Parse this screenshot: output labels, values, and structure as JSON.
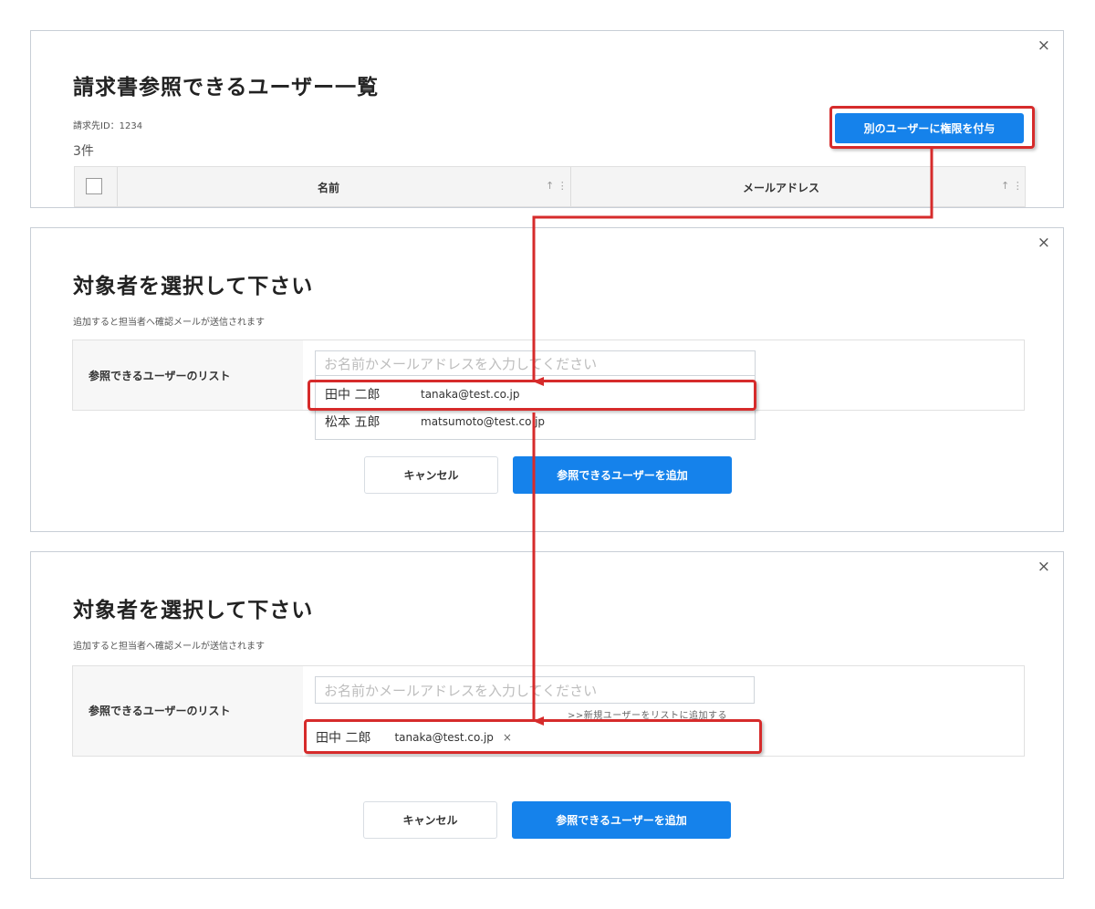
{
  "close_icon": "×",
  "panel1": {
    "title": "請求書参照できるユーザー一覧",
    "billing_id": "請求先ID：1234",
    "count": "3件",
    "grant_button": "別のユーザーに権限を付与",
    "columns": [
      {
        "label": "名前",
        "sort": "↑ ⋮"
      },
      {
        "label": "メールアドレス",
        "sort": "↑ ⋮"
      }
    ]
  },
  "panel2": {
    "title": "対象者を選択して下さい",
    "note": "追加すると担当者へ確認メールが送信されます",
    "field_label": "参照できるユーザーのリスト",
    "search_placeholder": "お名前かメールアドレスを入力してください",
    "options": [
      {
        "name": "田中 二郎",
        "email": "tanaka@test.co.jp"
      },
      {
        "name": "松本 五郎",
        "email": "matsumoto@test.co.jp"
      }
    ],
    "cancel_button": "キャンセル",
    "add_button": "参照できるユーザーを追加"
  },
  "panel3": {
    "title": "対象者を選択して下さい",
    "note": "追加すると担当者へ確認メールが送信されます",
    "field_label": "参照できるユーザーのリスト",
    "search_placeholder": "お名前かメールアドレスを入力してください",
    "new_user_link": ">>新規ユーザーをリストに追加する",
    "selected": {
      "name": "田中 二郎",
      "email": "tanaka@test.co.jp",
      "remove": "×"
    },
    "cancel_button": "キャンセル",
    "add_button": "参照できるユーザーを追加"
  },
  "colors": {
    "accent": "#1582eb",
    "highlight": "#d62b2b"
  }
}
